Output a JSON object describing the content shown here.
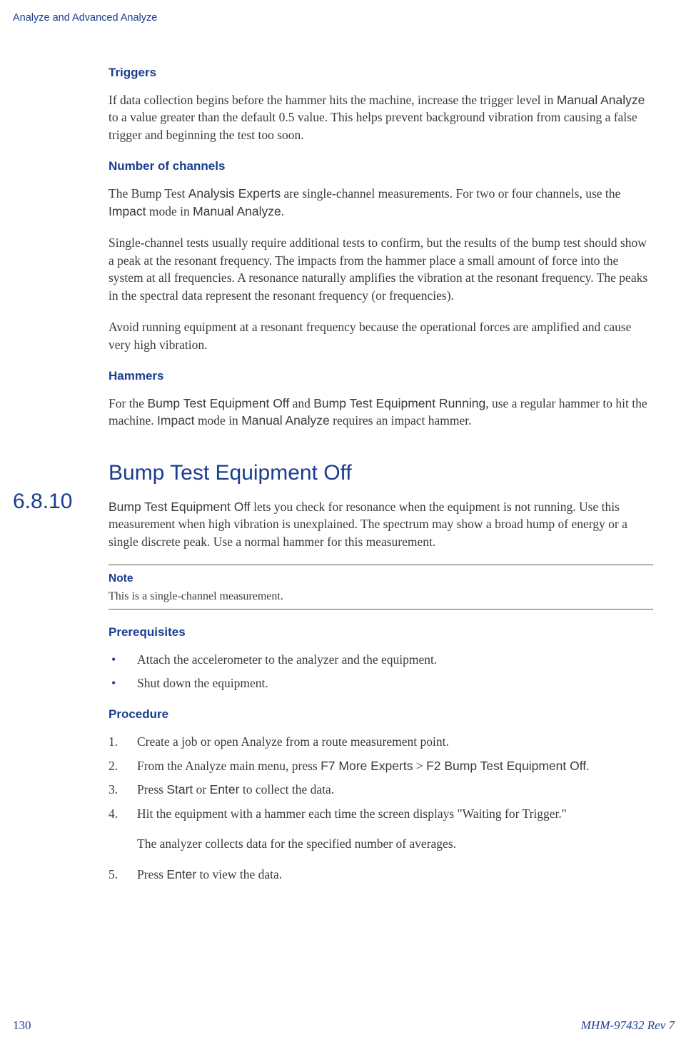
{
  "header": "Analyze and Advanced Analyze",
  "triggers": {
    "heading": "Triggers",
    "p1_a": "If data collection begins before the hammer hits the machine, increase the trigger level in ",
    "p1_term": "Manual Analyze",
    "p1_b": " to a value greater than the default 0.5 value. This helps prevent background vibration from causing a false trigger and beginning the test too soon."
  },
  "channels": {
    "heading": "Number of channels",
    "p1_a": "The Bump Test ",
    "p1_term1": "Analysis Experts",
    "p1_b": " are single-channel measurements. For two or four channels, use the ",
    "p1_term2": "Impact",
    "p1_c": " mode in ",
    "p1_term3": "Manual Analyze",
    "p1_d": ".",
    "p2": "Single-channel tests usually require additional tests to confirm, but the results of the bump test should show a peak at the resonant frequency. The impacts from the hammer place a small amount of force into the system at all frequencies. A resonance naturally amplifies the vibration at the resonant frequency. The peaks in the spectral data represent the resonant frequency (or frequencies).",
    "p3": "Avoid running equipment at a resonant frequency because the operational forces are amplified and cause very high vibration."
  },
  "hammers": {
    "heading": "Hammers",
    "p1_a": "For the ",
    "p1_term1": "Bump Test Equipment Off",
    "p1_b": " and ",
    "p1_term2": "Bump Test Equipment Running",
    "p1_c": ", use a regular hammer to hit the machine. ",
    "p1_term3": "Impact",
    "p1_d": " mode in ",
    "p1_term4": "Manual Analyze",
    "p1_e": " requires an impact hammer."
  },
  "section": {
    "number": "6.8.10",
    "title": "Bump Test Equipment Off",
    "intro_term": "Bump Test Equipment Off",
    "intro": " lets you check for resonance when the equipment is not running. Use this measurement when high vibration is unexplained. The spectrum may show a broad hump of energy or a single discrete peak. Use a normal hammer for this measurement.",
    "note_label": "Note",
    "note_text": "This is a single-channel measurement.",
    "prereq_heading": "Prerequisites",
    "prereq": [
      "Attach the accelerometer to the analyzer and the equipment.",
      "Shut down the equipment."
    ],
    "proc_heading": "Procedure",
    "steps": {
      "s1": "Create a job or open Analyze from a route measurement point.",
      "s2_a": "From the Analyze main menu, press ",
      "s2_t1": "F7 More Experts",
      "s2_b": " > ",
      "s2_t2": "F2 Bump Test Equipment Off",
      "s2_c": ".",
      "s3_a": "Press ",
      "s3_t1": "Start",
      "s3_b": " or ",
      "s3_t2": "Enter",
      "s3_c": " to collect the data.",
      "s4": "Hit the equipment with a hammer each time the screen displays \"Waiting for Trigger.\"",
      "s4_sub": "The analyzer collects data for the specified number of averages.",
      "s5_a": "Press ",
      "s5_t1": "Enter",
      "s5_b": " to view the data."
    }
  },
  "footer": {
    "page": "130",
    "doc": "MHM-97432 Rev 7"
  }
}
